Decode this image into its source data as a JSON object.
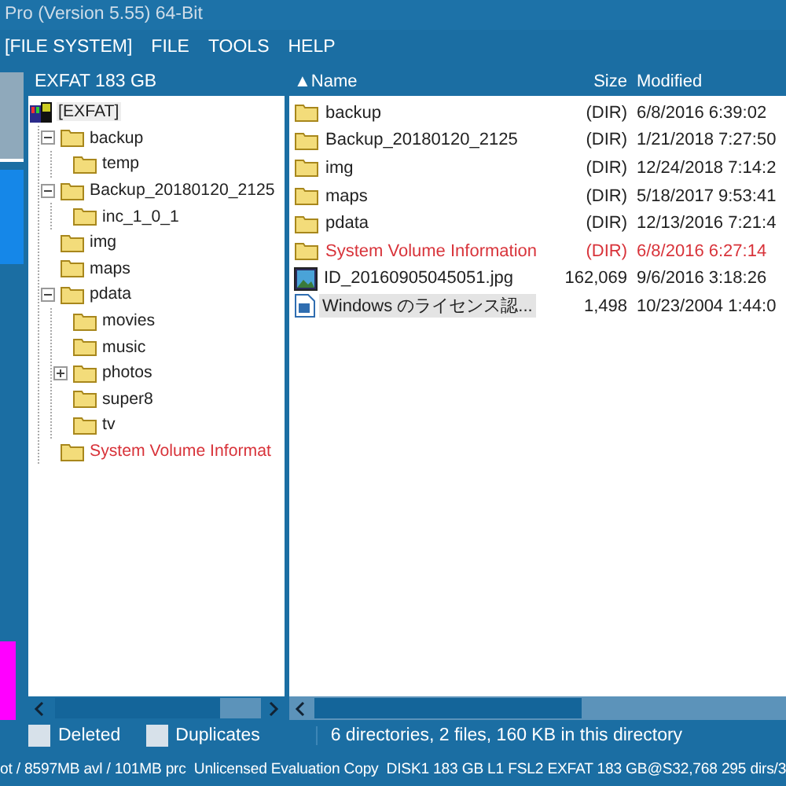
{
  "window": {
    "title": "Pro (Version 5.55) 64-Bit"
  },
  "menu": [
    "[FILE SYSTEM]",
    "FILE",
    "TOOLS",
    "HELP"
  ],
  "tree": {
    "header": "EXFAT 183 GB",
    "root": {
      "label": "[EXFAT]",
      "kind": "drive",
      "children": [
        {
          "label": "backup",
          "kind": "folder",
          "expanded": true,
          "children": [
            {
              "label": "temp",
              "kind": "folder"
            }
          ]
        },
        {
          "label": "Backup_20180120_2125",
          "kind": "folder",
          "expanded": true,
          "children": [
            {
              "label": "inc_1_0_1",
              "kind": "folder"
            }
          ]
        },
        {
          "label": "img",
          "kind": "folder"
        },
        {
          "label": "maps",
          "kind": "folder"
        },
        {
          "label": "pdata",
          "kind": "folder",
          "expanded": true,
          "children": [
            {
              "label": "movies",
              "kind": "folder"
            },
            {
              "label": "music",
              "kind": "folder"
            },
            {
              "label": "photos",
              "kind": "folder",
              "expanded": false
            },
            {
              "label": "super8",
              "kind": "folder"
            },
            {
              "label": "tv",
              "kind": "folder"
            }
          ]
        },
        {
          "label": "System Volume Informat",
          "kind": "system"
        }
      ]
    }
  },
  "files": {
    "columns": [
      {
        "label": "Name",
        "sort_arrow": "▲"
      },
      {
        "label": "Size"
      },
      {
        "label": "Modified"
      }
    ],
    "rows": [
      {
        "name": "backup",
        "size": "(DIR)",
        "modified": "6/8/2016 6:39:02",
        "kind": "folder",
        "selected": false
      },
      {
        "name": "Backup_20180120_2125",
        "size": "(DIR)",
        "modified": "1/21/2018 7:27:50",
        "kind": "folder",
        "selected": false
      },
      {
        "name": "img",
        "size": "(DIR)",
        "modified": "12/24/2018 7:14:2",
        "kind": "folder",
        "selected": false
      },
      {
        "name": "maps",
        "size": "(DIR)",
        "modified": "5/18/2017 9:53:41",
        "kind": "folder",
        "selected": false
      },
      {
        "name": "pdata",
        "size": "(DIR)",
        "modified": "12/13/2016 7:21:4",
        "kind": "folder",
        "selected": false
      },
      {
        "name": "System Volume Information",
        "size": "(DIR)",
        "modified": "6/8/2016 6:27:14",
        "kind": "system",
        "selected": false
      },
      {
        "name": "ID_20160905045051.jpg",
        "size": "162,069",
        "modified": "9/6/2016 3:18:26",
        "kind": "image",
        "selected": false
      },
      {
        "name": "Windows のライセンス認...",
        "size": "1,498",
        "modified": "10/23/2004 1:44:0",
        "kind": "document",
        "selected": true
      }
    ]
  },
  "legend": [
    "Deleted",
    "Duplicates"
  ],
  "status": "6 directories, 2 files, 160 KB in this directory",
  "status_bar": [
    "ot / 8597MB avl / 101MB prc",
    "Unlicensed Evaluation Copy",
    "DISK1 183 GB L1 FSL2 EXFAT 183 GB@S32,768 295 dirs/3"
  ]
}
